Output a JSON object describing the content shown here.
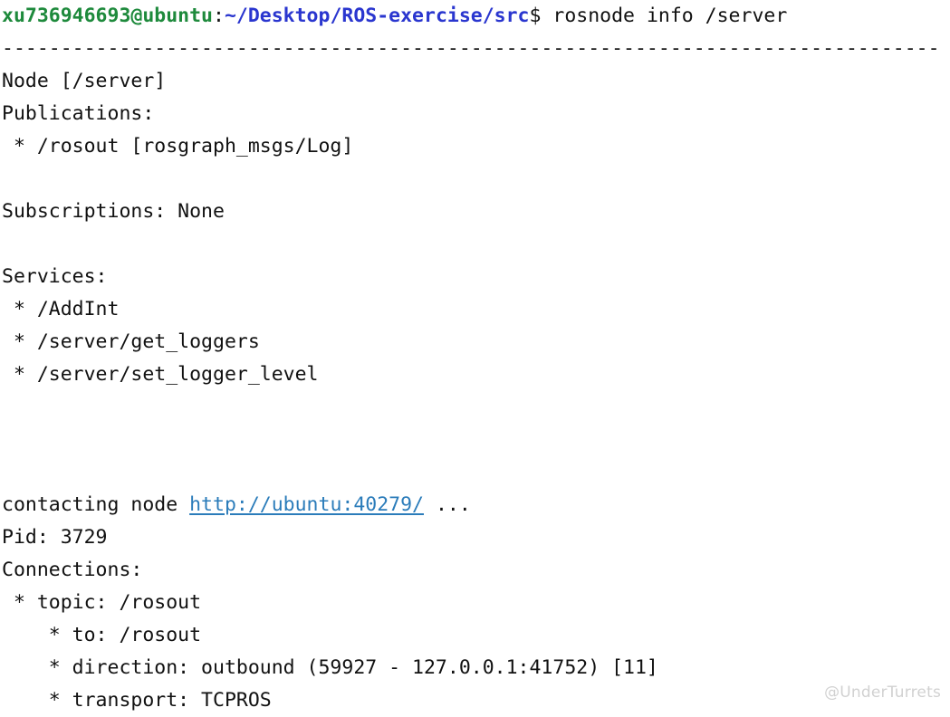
{
  "terminal": {
    "prompt": {
      "user_host": "xu736946693@ubuntu",
      "separator": ":",
      "path": "~/Desktop/ROS-exercise/src",
      "symbol": "$",
      "command": " rosnode info /server"
    },
    "separator_rule": "--------------------------------------------------------------------------------",
    "lines": [
      "Node [/server]",
      "Publications:",
      " * /rosout [rosgraph_msgs/Log]",
      "",
      "Subscriptions: None",
      "",
      "Services:",
      " * /AddInt",
      " * /server/get_loggers",
      " * /server/set_logger_level",
      "",
      "",
      ""
    ],
    "contacting": {
      "prefix": "contacting node ",
      "url": "http://ubuntu:40279/",
      "suffix": " ..."
    },
    "tail_lines": [
      "Pid: 3729",
      "Connections:",
      " * topic: /rosout",
      "    * to: /rosout",
      "    * direction: outbound (59927 - 127.0.0.1:41752) [11]",
      "    * transport: TCPROS"
    ]
  },
  "watermark": {
    "glyph": "\u0003\u0003 ",
    "text": "@UnderTurrets"
  },
  "colors": {
    "background": "#ffffff",
    "foreground": "#111111",
    "user_green": "#1e8a3c",
    "path_blue": "#2a36cf",
    "link_blue": "#2b7cba",
    "watermark_gray": "#c9c9c9"
  }
}
